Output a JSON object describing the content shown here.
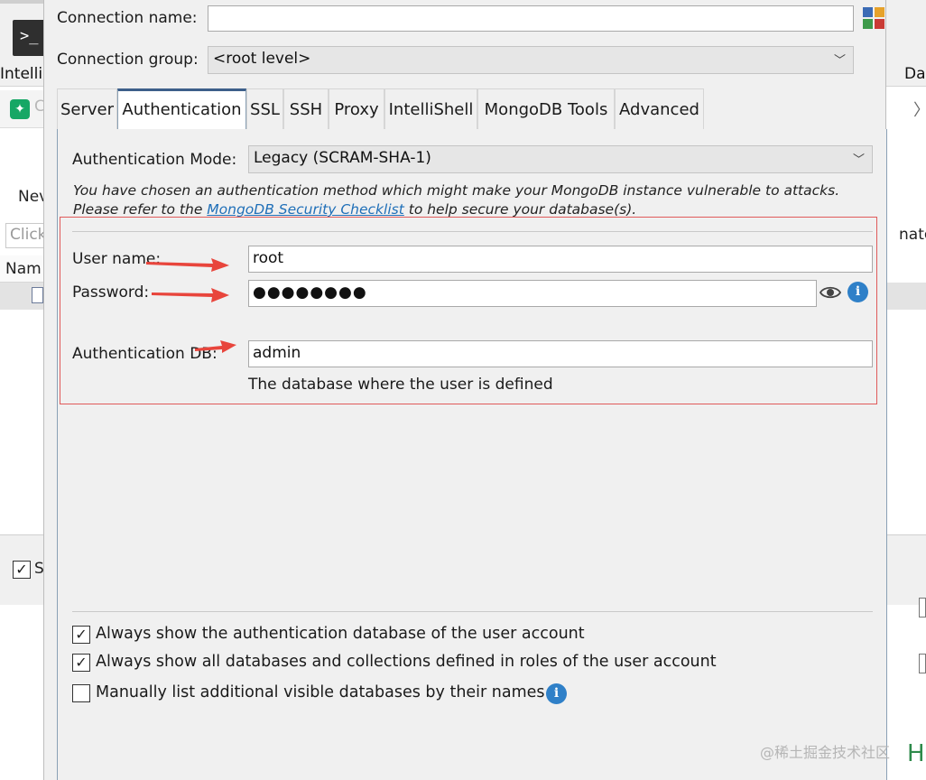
{
  "background": {
    "left_window_title": "IntelliS",
    "left_tab_label": "C",
    "left_new_label": "Nev",
    "left_search_placeholder": "Click",
    "left_column_header": "Nam",
    "left_checkbox_label": "S",
    "right_window_title": "Da",
    "right_text": "nato",
    "right_letter": "H",
    "terminal_glyph": ">_"
  },
  "dialog": {
    "connection_name_label": "Connection name:",
    "connection_name_value": "",
    "connection_group_label": "Connection group:",
    "connection_group_value": "<root level>",
    "color_icon": "color-picker-icon",
    "tabs": [
      {
        "label": "Server",
        "active": false
      },
      {
        "label": "Authentication",
        "active": true
      },
      {
        "label": "SSL",
        "active": false
      },
      {
        "label": "SSH",
        "active": false
      },
      {
        "label": "Proxy",
        "active": false
      },
      {
        "label": "IntelliShell",
        "active": false
      },
      {
        "label": "MongoDB Tools",
        "active": false
      },
      {
        "label": "Advanced",
        "active": false
      }
    ],
    "auth": {
      "mode_label": "Authentication Mode:",
      "mode_value": "Legacy (SCRAM-SHA-1)",
      "warning_line1": "You have chosen an authentication method which might make your MongoDB instance vulnerable to attacks.",
      "warning_line2_prefix": "Please refer to the ",
      "warning_link": "MongoDB Security Checklist",
      "warning_line2_suffix": " to help secure your database(s).",
      "username_label": "User name:",
      "username_value": "root",
      "password_label": "Password:",
      "password_value": "●●●●●●●●",
      "authdb_label": "Authentication DB:",
      "authdb_value": "admin",
      "authdb_hint": "The database where the user is defined"
    },
    "options": [
      {
        "label": "Always show the authentication database of the user account",
        "checked": true
      },
      {
        "label": "Always show all databases and collections defined in roles of the user account",
        "checked": true
      },
      {
        "label": "Manually list additional visible databases by their names",
        "checked": false
      }
    ],
    "check_mark": "✓",
    "info_glyph": "i"
  },
  "colors": {
    "annotation_red": "#e8453c",
    "tab_accent": "#3d5f8a",
    "link_blue": "#1f6fb8",
    "info_blue": "#2f80c8"
  },
  "watermark": "@稀土掘金技术社区"
}
